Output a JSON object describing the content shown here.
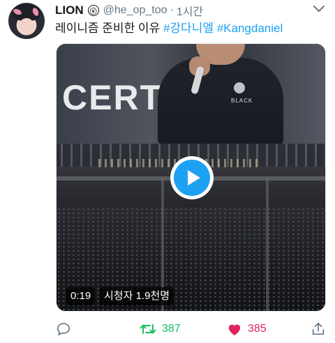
{
  "tweet": {
    "author_name": "LION",
    "verified_glyph": "ⓥ",
    "handle": "@he_op_too",
    "separator": "·",
    "time": "1시간",
    "text_plain": "레이니즘 준비한 이유",
    "hashtag_1": "#강다니엘",
    "hashtag_2": "#Kangdaniel"
  },
  "video": {
    "screen_text": "CERT",
    "shirt_text": "BLACK",
    "duration": "0:19",
    "views": "시청자 1.9천명"
  },
  "actions": {
    "reply_count": "",
    "retweet_count": "387",
    "like_count": "385"
  },
  "icons": {
    "chevron": "chevron-down-icon",
    "reply": "reply-icon",
    "retweet": "retweet-icon",
    "like": "heart-icon",
    "share": "share-icon",
    "play": "play-icon"
  },
  "colors": {
    "hashtag": "#1da1f2",
    "retweet_active": "#17bf63",
    "like_active": "#e0245e",
    "play_button": "#1da1f2",
    "secondary_text": "#657786"
  }
}
